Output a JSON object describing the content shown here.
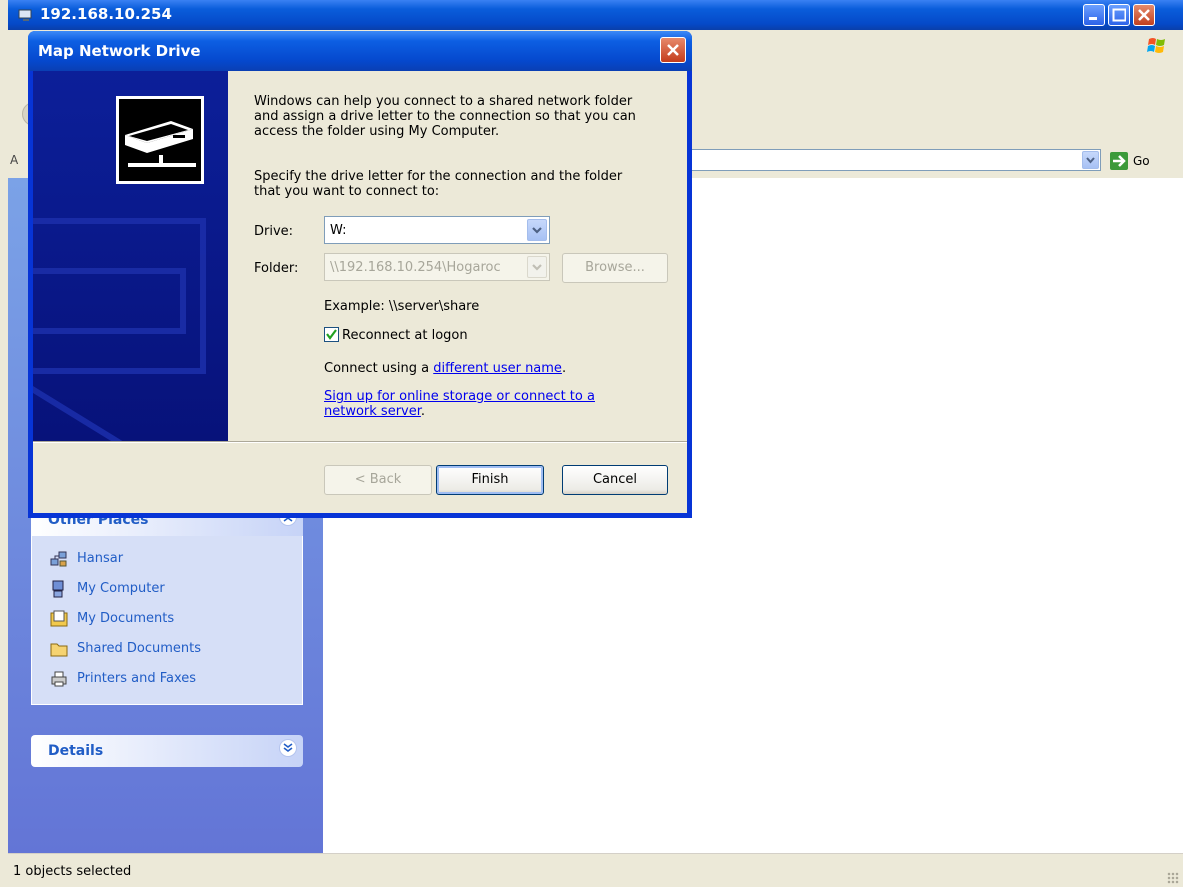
{
  "explorer": {
    "title": "192.168.10.254",
    "address_label": "A",
    "go_label": "Go",
    "status_text": "1 objects selected"
  },
  "other_places": {
    "title": "Other Places",
    "items": [
      {
        "label": "Hansar",
        "icon": "network-icon"
      },
      {
        "label": "My Computer",
        "icon": "computer-icon"
      },
      {
        "label": "My Documents",
        "icon": "documents-icon"
      },
      {
        "label": "Shared Documents",
        "icon": "folder-icon"
      },
      {
        "label": "Printers and Faxes",
        "icon": "printer-icon"
      }
    ]
  },
  "details": {
    "title": "Details"
  },
  "dialog": {
    "title": "Map Network Drive",
    "intro_lines": [
      "Windows can help you connect to a shared network folder",
      "and assign a drive letter to the connection so that you can",
      "access the folder using My Computer."
    ],
    "specify_lines": [
      "Specify the drive letter for the connection and the folder",
      "that you want to connect to:"
    ],
    "drive_label": "Drive:",
    "drive_value": "W:",
    "folder_label": "Folder:",
    "folder_value": "\\\\192.168.10.254\\Hogaroc",
    "browse_label": "Browse...",
    "example_text": "Example: \\\\server\\share",
    "reconnect_label": "Reconnect at logon",
    "reconnect_checked": true,
    "connect_prefix": "Connect using a ",
    "connect_link": "different user name",
    "connect_suffix": ".",
    "signup_line1": "Sign up for online storage or connect to a",
    "signup_line2": "network server",
    "signup_suffix": ".",
    "back_label": "< Back",
    "finish_label": "Finish",
    "cancel_label": "Cancel"
  }
}
